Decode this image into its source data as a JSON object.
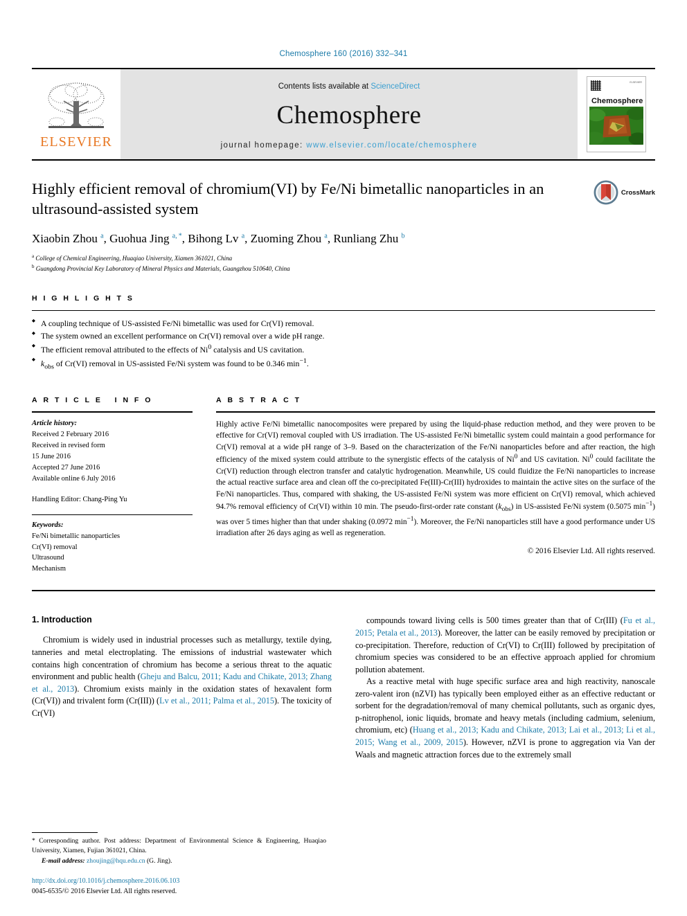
{
  "running_head": "Chemosphere 160 (2016) 332–341",
  "masthead": {
    "publisher_name": "ELSEVIER",
    "contents_prefix": "Contents lists available at ",
    "contents_link": "ScienceDirect",
    "journal_name": "Chemosphere",
    "homepage_prefix": "journal homepage: ",
    "homepage_link": "www.elsevier.com/locate/chemosphere",
    "cover_title": "Chemosphere",
    "cover_corner_text": "ELSEVIER"
  },
  "article": {
    "title": "Highly efficient removal of chromium(VI) by Fe/Ni bimetallic nanoparticles in an ultrasound-assisted system",
    "authors_html": "Xiaobin Zhou <sup>a</sup>, Guohua Jing <sup>a, *</sup>, Bihong Lv <sup>a</sup>, Zuoming Zhou <sup>a</sup>, Runliang Zhu <sup>b</sup>",
    "affiliations": [
      {
        "mark": "a",
        "text": "College of Chemical Engineering, Huaqiao University, Xiamen 361021, China"
      },
      {
        "mark": "b",
        "text": "Guangdong Provincial Key Laboratory of Mineral Physics and Materials, Guangzhou 510640, China"
      }
    ],
    "crossmark_label": "CrossMark"
  },
  "highlights": {
    "heading": "HIGHLIGHTS",
    "items_html": [
      "A coupling technique of US-assisted Fe/Ni bimetallic was used for Cr(VI) removal.",
      "The system owned an excellent performance on Cr(VI) removal over a wide pH range.",
      "The efficient removal attributed to the effects of Ni<sup>0</sup> catalysis and US cavitation.",
      "<i>k</i><sub>obs</sub> of Cr(VI) removal in US-assisted Fe/Ni system was found to be 0.346 min<sup>−1</sup>."
    ]
  },
  "article_info": {
    "heading": "ARTICLE INFO",
    "history_label": "Article history:",
    "history_lines": [
      "Received 2 February 2016",
      "Received in revised form",
      "15 June 2016",
      "Accepted 27 June 2016",
      "Available online 6 July 2016"
    ],
    "handling_editor": "Handling Editor: Chang-Ping Yu",
    "keywords_label": "Keywords:",
    "keywords": [
      "Fe/Ni bimetallic nanoparticles",
      "Cr(VI) removal",
      "Ultrasound",
      "Mechanism"
    ]
  },
  "abstract": {
    "heading": "ABSTRACT",
    "body_html": "Highly active Fe/Ni bimetallic nanocomposites were prepared by using the liquid-phase reduction method, and they were proven to be effective for Cr(VI) removal coupled with US irradiation. The US-assisted Fe/Ni bimetallic system could maintain a good performance for Cr(VI) removal at a wide pH range of 3–9. Based on the characterization of the Fe/Ni nanoparticles before and after reaction, the high efficiency of the mixed system could attribute to the synergistic effects of the catalysis of Ni<sup>0</sup> and US cavitation. Ni<sup>0</sup> could facilitate the Cr(VI) reduction through electron transfer and catalytic hydrogenation. Meanwhile, US could fluidize the Fe/Ni nanoparticles to increase the actual reactive surface area and clean off the co-precipitated Fe(III)-Cr(III) hydroxides to maintain the active sites on the surface of the Fe/Ni nanoparticles. Thus, compared with shaking, the US-assisted Fe/Ni system was more efficient on Cr(VI) removal, which achieved 94.7% removal efficiency of Cr(VI) within 10 min. The pseudo-first-order rate constant (<i>k</i><sub>obs</sub>) in US-assisted Fe/Ni system (0.5075 min<sup>−1</sup>) was over 5 times higher than that under shaking (0.0972 min<sup>−1</sup>). Moreover, the Fe/Ni nanoparticles still have a good performance under US irradiation after 26 days aging as well as regeneration.",
    "copyright": "© 2016 Elsevier Ltd. All rights reserved."
  },
  "introduction": {
    "section_number_title": "1. Introduction",
    "left_paragraph_html": "Chromium is widely used in industrial processes such as metallurgy, textile dying, tanneries and metal electroplating. The emissions of industrial wastewater which contains high concentration of chromium has become a serious threat to the aquatic environment and public health (<a class=\"cite\" href=\"#\">Gheju and Balcu, 2011; Kadu and Chikate, 2013; Zhang et al., 2013</a>). Chromium exists mainly in the oxidation states of hexavalent form (Cr(VI)) and trivalent form (Cr(III)) (<a class=\"cite\" href=\"#\">Lv et al., 2011; Palma et al., 2015</a>). The toxicity of Cr(VI)",
    "right_paragraph_1_html": "compounds toward living cells is 500 times greater than that of Cr(III) (<a class=\"cite\" href=\"#\">Fu et al., 2015; Petala et al., 2013</a>). Moreover, the latter can be easily removed by precipitation or co-precipitation. Therefore, reduction of Cr(VI) to Cr(III) followed by precipitation of chromium species was considered to be an effective approach applied for chromium pollution abatement.",
    "right_paragraph_2_html": "As a reactive metal with huge specific surface area and high reactivity, nanoscale zero-valent iron (nZVI) has typically been employed either as an effective reductant or sorbent for the degradation/removal of many chemical pollutants, such as organic dyes, p-nitrophenol, ionic liquids, bromate and heavy metals (including cadmium, selenium, chromium, etc) (<a class=\"cite\" href=\"#\">Huang et al., 2013; Kadu and Chikate, 2013; Lai et al., 2013; Li et al., 2015; Wang et al., 2009, 2015</a>). However, nZVI is prone to aggregation via Van der Waals and magnetic attraction forces due to the extremely small"
  },
  "footnotes": {
    "corresponding_html": "* Corresponding author. Post address: Department of Environmental Science &amp; Engineering, Huaqiao University, Xiamen, Fujian 361021, China.",
    "email_label": "E-mail address:",
    "email": "zhoujing@hqu.edu.cn",
    "email_suffix": "(G. Jing).",
    "doi": "http://dx.doi.org/10.1016/j.chemosphere.2016.06.103",
    "issn_line": "0045-6535/© 2016 Elsevier Ltd. All rights reserved."
  },
  "colors": {
    "link": "#1a7aa8",
    "elsevier_orange": "#E87722",
    "masthead_grey": "#e3e3e3"
  }
}
